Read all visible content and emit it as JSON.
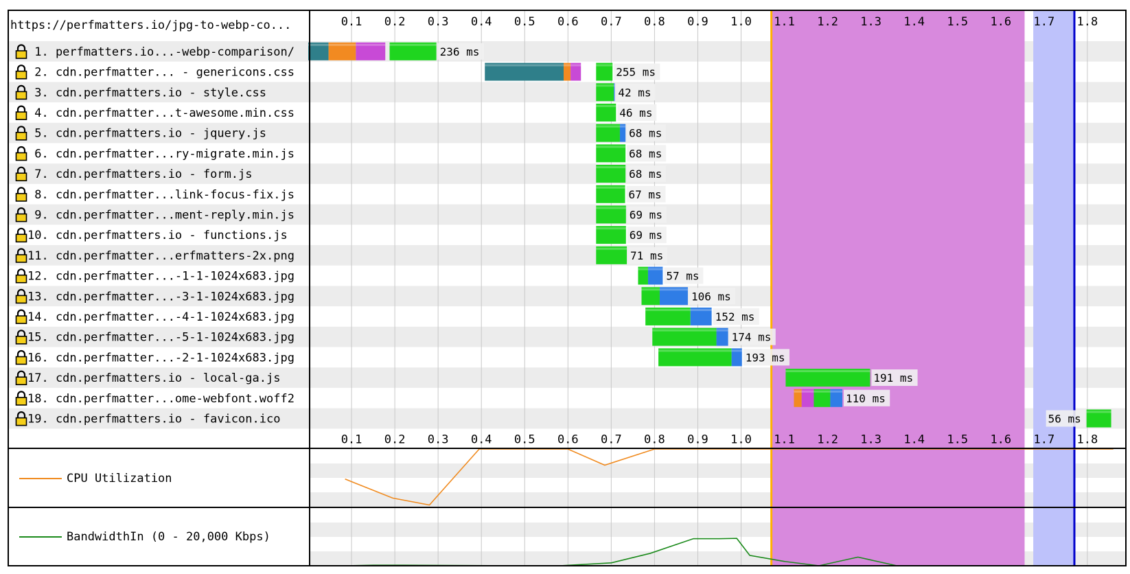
{
  "page_url": "https://perfmatters.io/jpg-to-webp-co...",
  "colors": {
    "dns": "#2f7f8a",
    "connect": "#f28a21",
    "ssl": "#c84ad6",
    "ttfb": "#1fd51f",
    "download": "#2f7de6",
    "row_alt": "#ececec",
    "grid": "#c8c8c8",
    "dom_interactive": "#d889dd",
    "load_event": "#bec2fb",
    "start_render": "#ffb000",
    "doc_complete": "#0000cc",
    "cpu_line": "#f08a1e",
    "bw_line": "#1b8a1b"
  },
  "chart_data": [
    {
      "type": "waterfall",
      "title": "https://perfmatters.io/jpg-to-webp-co...",
      "xlim": [
        0.0,
        1.86
      ],
      "x_ticks": [
        "0.1",
        "0.2",
        "0.3",
        "0.4",
        "0.5",
        "0.6",
        "0.7",
        "0.8",
        "0.9",
        "1.0",
        "1.1",
        "1.2",
        "1.3",
        "1.4",
        "1.5",
        "1.6",
        "1.7",
        "1.8"
      ],
      "grid": true,
      "markers": {
        "start_render": 1.07,
        "dom_content_loaded": [
          1.07,
          1.655
        ],
        "load_event": [
          1.675,
          1.77
        ],
        "document_complete": 1.77
      },
      "requests": [
        {
          "label": " 1. perfmatters.io...-webp-comparison/",
          "duration": "236 ms",
          "phases": [
            [
              "dns",
              0.0,
              0.047
            ],
            [
              "connect",
              0.047,
              0.11
            ],
            [
              "ssl",
              0.11,
              0.178
            ],
            [
              "ttfb",
              0.188,
              0.296
            ]
          ]
        },
        {
          "label": " 2. cdn.perfmatter... - genericons.css",
          "duration": "255 ms",
          "phases": [
            [
              "dns",
              0.408,
              0.59
            ],
            [
              "connect",
              0.59,
              0.606
            ],
            [
              "ssl",
              0.606,
              0.63
            ],
            [
              "ttfb",
              0.665,
              0.703
            ]
          ]
        },
        {
          "label": " 3. cdn.perfmatters.io - style.css",
          "duration": "42 ms",
          "phases": [
            [
              "ttfb",
              0.665,
              0.706
            ],
            [
              "download",
              0.706,
              0.708
            ]
          ]
        },
        {
          "label": " 4. cdn.perfmatter...t-awesome.min.css",
          "duration": "46 ms",
          "phases": [
            [
              "ttfb",
              0.665,
              0.711
            ]
          ]
        },
        {
          "label": " 5. cdn.perfmatters.io - jquery.js",
          "duration": "68 ms",
          "phases": [
            [
              "ttfb",
              0.665,
              0.72
            ],
            [
              "download",
              0.72,
              0.733
            ]
          ]
        },
        {
          "label": " 6. cdn.perfmatter...ry-migrate.min.js",
          "duration": "68 ms",
          "phases": [
            [
              "ttfb",
              0.665,
              0.733
            ]
          ]
        },
        {
          "label": " 7. cdn.perfmatters.io - form.js",
          "duration": "68 ms",
          "phases": [
            [
              "ttfb",
              0.665,
              0.733
            ]
          ]
        },
        {
          "label": " 8. cdn.perfmatter...link-focus-fix.js",
          "duration": "67 ms",
          "phases": [
            [
              "ttfb",
              0.665,
              0.732
            ]
          ]
        },
        {
          "label": " 9. cdn.perfmatter...ment-reply.min.js",
          "duration": "69 ms",
          "phases": [
            [
              "ttfb",
              0.665,
              0.734
            ]
          ]
        },
        {
          "label": "10. cdn.perfmatters.io - functions.js",
          "duration": "69 ms",
          "phases": [
            [
              "ttfb",
              0.665,
              0.734
            ]
          ]
        },
        {
          "label": "11. cdn.perfmatter...erfmatters-2x.png",
          "duration": "71 ms",
          "phases": [
            [
              "ttfb",
              0.665,
              0.736
            ]
          ]
        },
        {
          "label": "12. cdn.perfmatter...-1-1-1024x683.jpg",
          "duration": "57 ms",
          "phases": [
            [
              "ttfb",
              0.762,
              0.785
            ],
            [
              "download",
              0.785,
              0.819
            ]
          ]
        },
        {
          "label": "13. cdn.perfmatter...-3-1-1024x683.jpg",
          "duration": "106 ms",
          "phases": [
            [
              "ttfb",
              0.77,
              0.812
            ],
            [
              "download",
              0.812,
              0.877
            ]
          ]
        },
        {
          "label": "14. cdn.perfmatter...-4-1-1024x683.jpg",
          "duration": "152 ms",
          "phases": [
            [
              "ttfb",
              0.779,
              0.883
            ],
            [
              "download",
              0.883,
              0.932
            ]
          ]
        },
        {
          "label": "15. cdn.perfmatter...-5-1-1024x683.jpg",
          "duration": "174 ms",
          "phases": [
            [
              "ttfb",
              0.795,
              0.943
            ],
            [
              "download",
              0.943,
              0.97
            ]
          ]
        },
        {
          "label": "16. cdn.perfmatter...-2-1-1024x683.jpg",
          "duration": "193 ms",
          "phases": [
            [
              "ttfb",
              0.809,
              0.978
            ],
            [
              "download",
              0.978,
              1.002
            ]
          ]
        },
        {
          "label": "17. cdn.perfmatters.io - local-ga.js",
          "duration": "191 ms",
          "phases": [
            [
              "ttfb",
              1.103,
              1.298
            ]
          ]
        },
        {
          "label": "18. cdn.perfmatter...ome-webfont.woff2",
          "duration": "110 ms",
          "phases": [
            [
              "connect",
              1.122,
              1.14
            ],
            [
              "ssl",
              1.14,
              1.168
            ],
            [
              "ttfb",
              1.168,
              1.206
            ],
            [
              "download",
              1.206,
              1.234
            ]
          ]
        },
        {
          "label": "19. cdn.perfmatters.io - favicon.ico",
          "duration": "56 ms",
          "duration_side": "left",
          "phases": [
            [
              "ttfb",
              1.798,
              1.855
            ]
          ]
        }
      ]
    },
    {
      "type": "line",
      "name": "CPU Utilization",
      "ylim": [
        0,
        100
      ],
      "x": [
        0.085,
        0.195,
        0.28,
        0.395,
        0.6,
        0.685,
        0.8,
        1.86
      ],
      "y": [
        48,
        15,
        3,
        100,
        100,
        72,
        100,
        100
      ]
    },
    {
      "type": "line",
      "name": "BandwidthIn (0 - 20,000 Kbps)",
      "ylim": [
        0,
        20000
      ],
      "x": [
        0.085,
        0.15,
        0.22,
        0.5,
        0.58,
        0.7,
        0.79,
        0.89,
        0.95,
        0.99,
        1.02,
        1.1,
        1.18,
        1.27,
        1.36,
        1.86
      ],
      "y": [
        0,
        200,
        200,
        0,
        0,
        1000,
        4300,
        9400,
        9400,
        9500,
        3600,
        1500,
        0,
        3000,
        0,
        0
      ]
    }
  ]
}
